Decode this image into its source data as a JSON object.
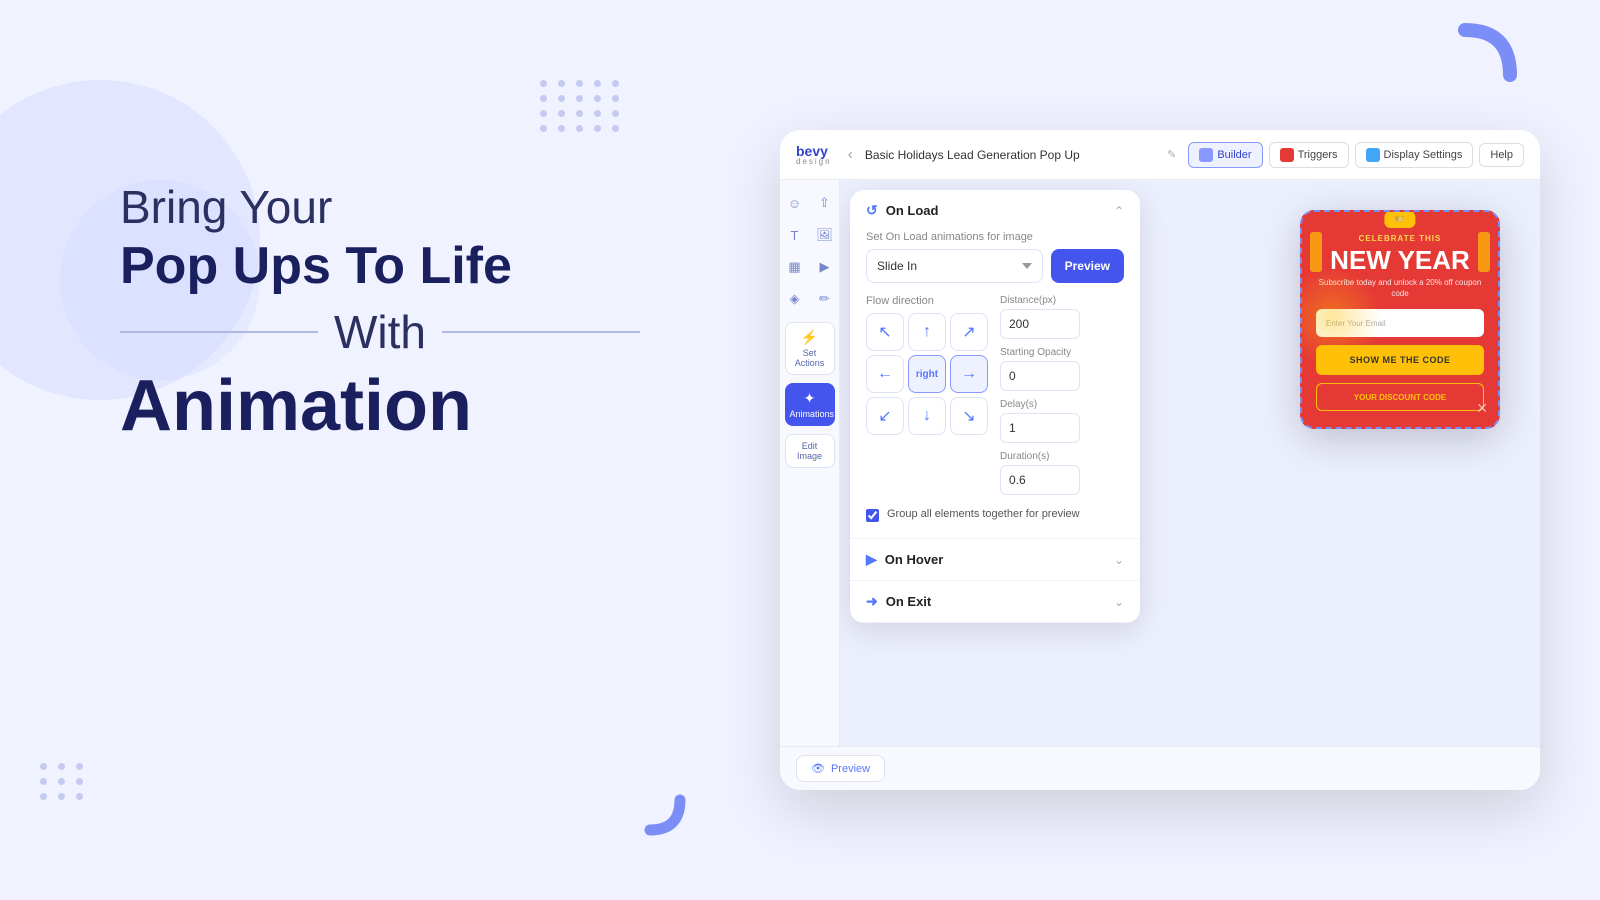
{
  "page": {
    "bg_color": "#f0f2ff"
  },
  "hero": {
    "line1": "Bring Your",
    "line2": "Pop Ups To Life",
    "line3": "With",
    "line4": "Animation"
  },
  "builder": {
    "logo": {
      "name": "bevy",
      "sub": "design"
    },
    "title": "Basic Holidays Lead Generation Pop Up",
    "nav": {
      "builder": "Builder",
      "triggers": "Triggers",
      "display_settings": "Display Settings",
      "help": "Help"
    },
    "animation_panel": {
      "on_load": {
        "title": "On Load",
        "label": "Set On Load animations for image",
        "animation_type": "Slide In",
        "preview_btn": "Preview",
        "flow_direction_label": "Flow direction",
        "directions": [
          {
            "symbol": "↖",
            "label": "top-left"
          },
          {
            "symbol": "↑",
            "label": "up"
          },
          {
            "symbol": "↗",
            "label": "top-right"
          },
          {
            "symbol": "←",
            "label": "left"
          },
          {
            "symbol": "right",
            "label": "right"
          },
          {
            "symbol": "→",
            "label": "right-arrow"
          },
          {
            "symbol": "↙",
            "label": "bottom-left"
          },
          {
            "symbol": "↓",
            "label": "down"
          },
          {
            "symbol": "↘",
            "label": "bottom-right"
          }
        ],
        "distance_label": "Distance(px)",
        "distance_value": "200",
        "starting_opacity_label": "Starting Opacity",
        "starting_opacity_value": "0",
        "delay_label": "Delay(s)",
        "delay_value": "1",
        "duration_label": "Duration(s)",
        "duration_value": "0.6",
        "group_checkbox_label": "Group all elements together for preview",
        "group_checked": true
      },
      "on_hover": {
        "title": "On Hover"
      },
      "on_exit": {
        "title": "On Exit"
      },
      "preview_btn": "Preview"
    },
    "popup_card": {
      "badge": "🎫",
      "celebrate": "CELEBRATE THIS",
      "new_year": "NEW YEAR",
      "subtitle": "Subscribe today and unlock a 20% off coupon code",
      "email_placeholder": "Enter Your Email",
      "cta_btn": "SHOW ME THE CODE",
      "discount_btn": "YOUR DISCOUNT CODE"
    },
    "bottom": {
      "preview_btn": "Preview"
    }
  }
}
